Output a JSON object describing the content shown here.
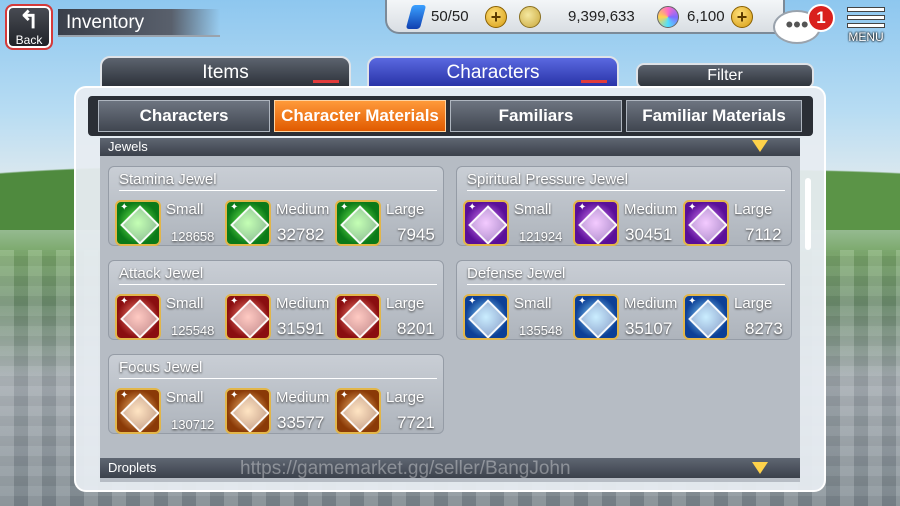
{
  "header": {
    "back_label": "Back",
    "title": "Inventory",
    "stamina": "50/50",
    "gold": "9,399,633",
    "gems": "6,100",
    "plus": "+",
    "notifications": "1",
    "menu_label": "MENU"
  },
  "tabs": {
    "items": "Items",
    "characters": "Characters",
    "filter": "Filter"
  },
  "subtabs": [
    "Characters",
    "Character Materials",
    "Familiars",
    "Familiar Materials"
  ],
  "sections": {
    "jewels": "Jewels",
    "droplets": "Droplets"
  },
  "size_labels": {
    "small": "Small",
    "medium": "Medium",
    "large": "Large"
  },
  "cards": [
    {
      "name": "Stamina Jewel",
      "small": "128658",
      "medium": "32782",
      "large": "7945",
      "color": "#1fae2a"
    },
    {
      "name": "Spiritual Pressure Jewel",
      "small": "121924",
      "medium": "30451",
      "large": "7112",
      "color": "#9c3ad8"
    },
    {
      "name": "Attack Jewel",
      "small": "125548",
      "medium": "31591",
      "large": "8201",
      "color": "#c8262a"
    },
    {
      "name": "Defense Jewel",
      "small": "135548",
      "medium": "35107",
      "large": "8273",
      "color": "#2a6ad0"
    },
    {
      "name": "Focus Jewel",
      "small": "130712",
      "medium": "33577",
      "large": "7721",
      "color": "#d07020"
    }
  ],
  "watermark": "https://gamemarket.gg/seller/BangJohn",
  "colors": {
    "active_tab": "#e86a0a",
    "characters_tab": "#3a46c4"
  }
}
